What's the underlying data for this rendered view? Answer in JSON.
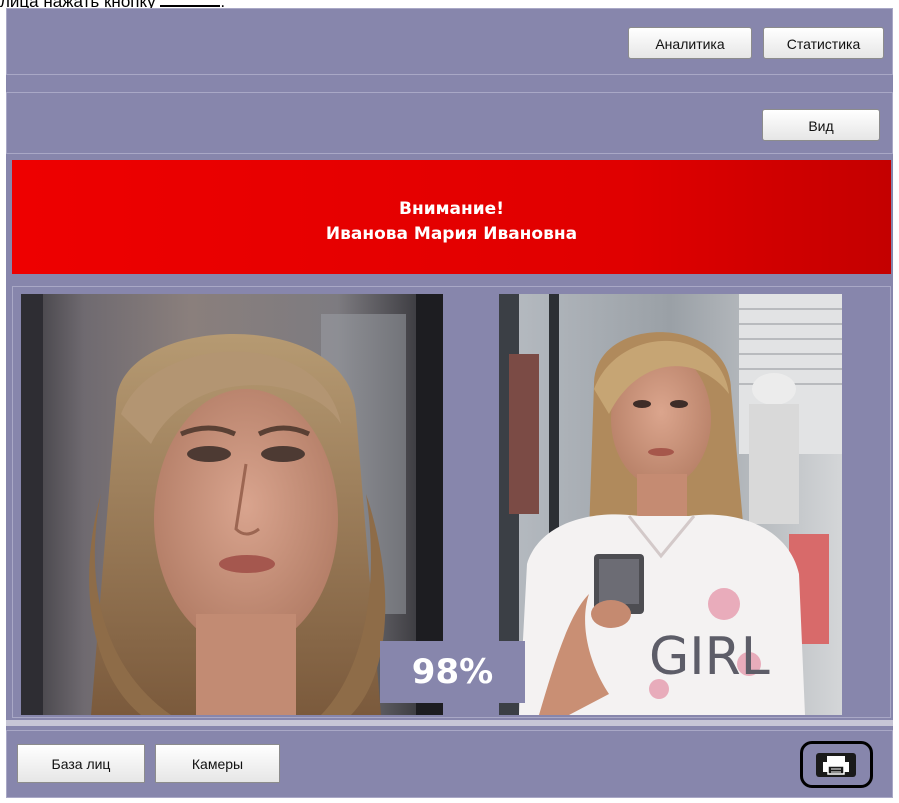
{
  "caption": {
    "text": "лица нажать кнопку"
  },
  "top_panel": {
    "analytics_label": "Аналитика",
    "statistics_label": "Статистика"
  },
  "view_panel": {
    "view_label": "Вид"
  },
  "alert": {
    "line1": "Внимание!",
    "line2": "Иванова Мария Ивановна",
    "color": "#e60000"
  },
  "match": {
    "percent": "98%"
  },
  "bottom_bar": {
    "face_db_label": "База лиц",
    "cameras_label": "Камеры",
    "print_icon": "printer-icon"
  },
  "colors": {
    "window_bg": "#8786ac",
    "alert_bg": "#e60000"
  }
}
